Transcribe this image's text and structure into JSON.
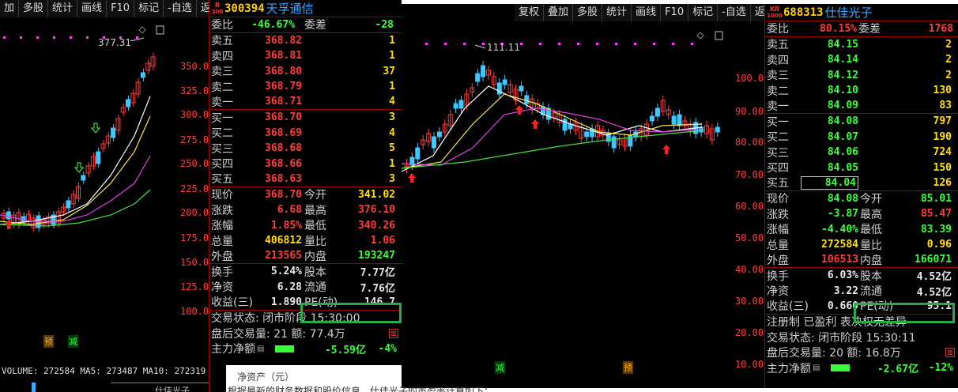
{
  "toolbar_left": [
    "加",
    "多股",
    "统计",
    "画线",
    "F10",
    "标记",
    "-自选",
    "返回"
  ],
  "toolbar_right": [
    "复权",
    "叠加",
    "多股",
    "统计",
    "画线",
    "F10",
    "标记",
    "-自选",
    "返回"
  ],
  "left": {
    "axis_labels": [
      "350.0",
      "325.0",
      "300.0",
      "275.0",
      "250.0",
      "225.0",
      "200.0",
      "175.0",
      "150.0",
      "125.0",
      "100.0"
    ],
    "high_annotation": "377.31",
    "marker_yu": "预",
    "marker_jian": "减",
    "volume_line": "VOLUME: 272584 MA5: 273487 MA10: 272319",
    "bottom_text": "仕佳光子"
  },
  "right": {
    "axis_labels": [
      "100.0",
      "90.00",
      "80.00",
      "70.00",
      "60.00",
      "50.00",
      "40.00",
      "30.00",
      "20.00",
      "10.00"
    ],
    "high_annotation": "111.11",
    "marker_jian": "减",
    "marker_yu": "预"
  },
  "q1": {
    "badge_top": "R",
    "badge_bottom": "300",
    "code": "300394",
    "name": "天孚通信",
    "webi_label": "委比",
    "webi_value": "-46.67%",
    "weicha_label": "委差",
    "weicha_value": "-28",
    "sells": [
      {
        "label": "卖五",
        "price": "368.82",
        "vol": "1"
      },
      {
        "label": "卖四",
        "price": "368.81",
        "vol": "1"
      },
      {
        "label": "卖三",
        "price": "368.80",
        "vol": "37"
      },
      {
        "label": "卖二",
        "price": "368.79",
        "vol": "1"
      },
      {
        "label": "卖一",
        "price": "368.71",
        "vol": "4"
      }
    ],
    "buys": [
      {
        "label": "买一",
        "price": "368.70",
        "vol": "3"
      },
      {
        "label": "买二",
        "price": "368.69",
        "vol": "4"
      },
      {
        "label": "买三",
        "price": "368.68",
        "vol": "5"
      },
      {
        "label": "买四",
        "price": "368.66",
        "vol": "1"
      },
      {
        "label": "买五",
        "price": "368.63",
        "vol": "3"
      }
    ],
    "stats": [
      {
        "l1": "现价",
        "v1": "368.70",
        "l2": "今开",
        "v2": "341.02"
      },
      {
        "l1": "涨跌",
        "v1": "6.68",
        "l2": "最高",
        "v2": "376.10"
      },
      {
        "l1": "涨幅",
        "v1": "1.85%",
        "l2": "最低",
        "v2": "340.26"
      },
      {
        "l1": "总量",
        "v1": "406812",
        "l2": "量比",
        "v2": "1.06"
      },
      {
        "l1": "外盘",
        "v1": "213565",
        "l2": "内盘",
        "v2": "193247"
      }
    ],
    "fin": [
      {
        "l1": "换手",
        "v1": "5.24%",
        "l2": "股本",
        "v2": "7.77亿"
      },
      {
        "l1": "净资",
        "v1": "6.28",
        "l2": "流通",
        "v2": "7.76亿"
      },
      {
        "l1": "收益(三)",
        "v1": "1.890",
        "l2": "PE(动)",
        "v2": "146.7"
      }
    ],
    "trade_status": "交易状态: 闭市阶段 15:30:00",
    "after_hours": "盘后交易量: 21 额: 77.4万",
    "main_label": "主力净额",
    "main_value": "-5.59亿",
    "main_pct": "-4%",
    "bottom_text": "净资产（元）"
  },
  "q2": {
    "badge_top": "KR",
    "badge_bottom": "1000",
    "code": "688313",
    "name": "仕佳光子",
    "webi_label": "委比",
    "webi_value": "80.15%",
    "weicha_label": "委差",
    "weicha_value": "1768",
    "sells": [
      {
        "label": "卖五",
        "price": "84.15",
        "vol": "2"
      },
      {
        "label": "卖四",
        "price": "84.14",
        "vol": "2"
      },
      {
        "label": "卖三",
        "price": "84.12",
        "vol": "2"
      },
      {
        "label": "卖二",
        "price": "84.10",
        "vol": "130"
      },
      {
        "label": "卖一",
        "price": "84.09",
        "vol": "83"
      }
    ],
    "buys": [
      {
        "label": "买一",
        "price": "84.08",
        "vol": "797"
      },
      {
        "label": "买二",
        "price": "84.07",
        "vol": "190"
      },
      {
        "label": "买三",
        "price": "84.06",
        "vol": "724"
      },
      {
        "label": "买四",
        "price": "84.05",
        "vol": "150"
      },
      {
        "label": "买五",
        "price": "84.04",
        "vol": "126"
      }
    ],
    "stats": [
      {
        "l1": "现价",
        "v1": "84.08",
        "l2": "今开",
        "v2": "85.01"
      },
      {
        "l1": "涨跌",
        "v1": "-3.87",
        "l2": "最高",
        "v2": "85.47"
      },
      {
        "l1": "涨幅",
        "v1": "-4.40%",
        "l2": "最低",
        "v2": "83.39"
      },
      {
        "l1": "总量",
        "v1": "272584",
        "l2": "量比",
        "v2": "0.96"
      },
      {
        "l1": "外盘",
        "v1": "106513",
        "l2": "内盘",
        "v2": "166071"
      }
    ],
    "fin": [
      {
        "l1": "换手",
        "v1": "6.03%",
        "l2": "股本",
        "v2": "4.52亿"
      },
      {
        "l1": "净资",
        "v1": "3.22",
        "l2": "流通",
        "v2": "4.52亿"
      },
      {
        "l1": "收益(三)",
        "v1": "0.660",
        "l2": "PE(动)",
        "v2": "95.1"
      }
    ],
    "register": "注册制 已盈利 表决权无差异",
    "trade_status": "交易状态: 闭市阶段 15:30:11",
    "after_hours": "盘后交易量: 20 额: 16.8万",
    "main_label": "主力净额",
    "main_value": "-2.67亿",
    "main_pct": "-12%"
  },
  "caption": "根据最新的财务数据和股价信息，仕佳光子的市盈率计算如下："
}
